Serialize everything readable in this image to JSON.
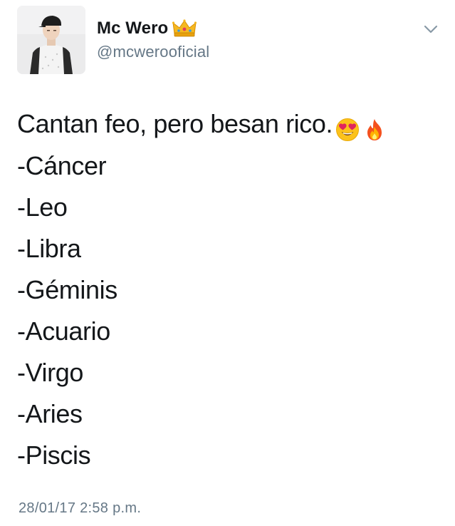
{
  "author": {
    "display_name": "Mc Wero",
    "handle": "@mcwerooficial",
    "badge_icon": "crown-icon"
  },
  "tweet": {
    "lead_text": "Cantan feo, pero besan rico.",
    "lead_emojis": [
      "heart-eyes-emoji-icon",
      "fire-emoji-icon"
    ],
    "signs": [
      "-Cáncer",
      "-Leo",
      "-Libra",
      "-Géminis",
      "-Acuario",
      "-Virgo",
      "-Aries",
      "-Piscis"
    ],
    "timestamp": "28/01/17 2:58 p.m."
  },
  "colors": {
    "text_primary": "#14171a",
    "text_secondary": "#657786",
    "caret": "#8899a6"
  }
}
